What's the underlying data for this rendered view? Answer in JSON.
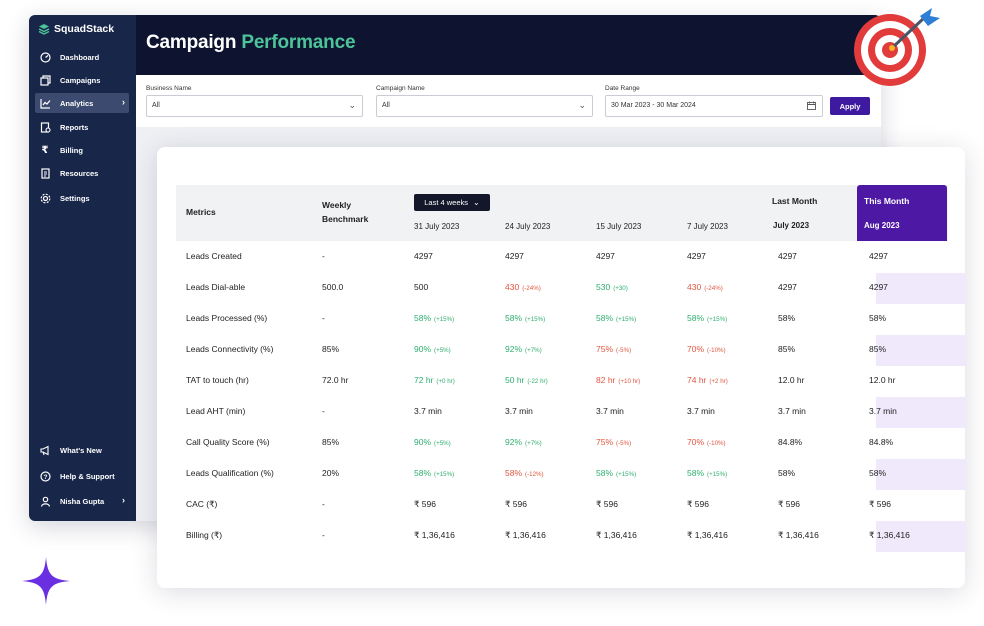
{
  "app": {
    "brand": "SquadStack",
    "title_prefix": "Campaign",
    "title_highlight": "Performance"
  },
  "sidebar": {
    "items": [
      {
        "label": "Dashboard",
        "icon": "dashboard-icon"
      },
      {
        "label": "Campaigns",
        "icon": "campaigns-icon"
      },
      {
        "label": "Analytics",
        "icon": "analytics-icon",
        "active": true
      },
      {
        "label": "Reports",
        "icon": "reports-icon"
      },
      {
        "label": "Billing",
        "icon": "rupee-icon"
      },
      {
        "label": "Resources",
        "icon": "resources-icon"
      },
      {
        "label": "Settings",
        "icon": "gear-icon"
      }
    ],
    "bottom_items": [
      {
        "label": "What's New",
        "icon": "megaphone-icon"
      },
      {
        "label": "Help & Support",
        "icon": "help-icon"
      },
      {
        "label": "Nisha Gupta",
        "icon": "user-icon"
      }
    ]
  },
  "filters": {
    "business_label": "Business Name",
    "business_value": "All",
    "campaign_label": "Campaign Name",
    "campaign_value": "All",
    "date_label": "Date Range",
    "date_value": "30 Mar 2023 - 30 Mar 2024",
    "apply_label": "Apply"
  },
  "table": {
    "headers": {
      "metrics": "Metrics",
      "weekly_benchmark_line1": "Weekly",
      "weekly_benchmark_line2": "Benchmark",
      "period_button": "Last 4 weeks",
      "weeks": [
        "31 July 2023",
        "24 July 2023",
        "15 July 2023",
        "7 July 2023"
      ],
      "last_month": "Last Month",
      "last_month_sub": "July 2023",
      "this_month": "This Month",
      "this_month_sub": "Aug 2023"
    },
    "rows": [
      {
        "metric": "Leads Created",
        "benchmark": "-",
        "weeks": [
          {
            "v": "4297",
            "d": ""
          },
          {
            "v": "4297",
            "d": ""
          },
          {
            "v": "4297",
            "d": ""
          },
          {
            "v": "4297",
            "d": ""
          }
        ],
        "last": "4297",
        "this": "4297",
        "hl": false
      },
      {
        "metric": "Leads Dial-able",
        "benchmark": "500.0",
        "weeks": [
          {
            "v": "500",
            "d": ""
          },
          {
            "v": "430",
            "d": "(-24%)",
            "s": "neg"
          },
          {
            "v": "530",
            "d": "(+30)",
            "s": "pos"
          },
          {
            "v": "430",
            "d": "(-24%)",
            "s": "neg"
          }
        ],
        "last": "4297",
        "this": "4297",
        "hl": true
      },
      {
        "metric": "Leads Processed (%)",
        "benchmark": "-",
        "weeks": [
          {
            "v": "58%",
            "d": "(+15%)",
            "s": "pos"
          },
          {
            "v": "58%",
            "d": "(+15%)",
            "s": "pos"
          },
          {
            "v": "58%",
            "d": "(+15%)",
            "s": "pos"
          },
          {
            "v": "58%",
            "d": "(+15%)",
            "s": "pos"
          }
        ],
        "last": "58%",
        "this": "58%",
        "hl": false
      },
      {
        "metric": "Leads  Connectivity (%)",
        "benchmark": "85%",
        "weeks": [
          {
            "v": "90%",
            "d": "(+5%)",
            "s": "pos"
          },
          {
            "v": "92%",
            "d": "(+7%)",
            "s": "pos"
          },
          {
            "v": "75%",
            "d": "(-5%)",
            "s": "neg"
          },
          {
            "v": "70%",
            "d": "(-10%)",
            "s": "neg"
          }
        ],
        "last": "85%",
        "this": "85%",
        "hl": true
      },
      {
        "metric": "TAT to touch (hr)",
        "benchmark": "72.0 hr",
        "weeks": [
          {
            "v": "72 hr",
            "d": "(+0 hr)",
            "s": "pos"
          },
          {
            "v": "50 hr",
            "d": "(-22 hr)",
            "s": "pos"
          },
          {
            "v": "82 hr",
            "d": "(+10 hr)",
            "s": "neg"
          },
          {
            "v": "74 hr",
            "d": "(+2 hr)",
            "s": "neg"
          }
        ],
        "last": "12.0 hr",
        "this": "12.0 hr",
        "hl": false
      },
      {
        "metric": "Lead AHT (min)",
        "benchmark": "-",
        "weeks": [
          {
            "v": "3.7 min",
            "d": ""
          },
          {
            "v": "3.7 min",
            "d": ""
          },
          {
            "v": "3.7 min",
            "d": ""
          },
          {
            "v": "3.7 min",
            "d": ""
          }
        ],
        "last": "3.7 min",
        "this": "3.7 min",
        "hl": true
      },
      {
        "metric": "Call Quality Score (%)",
        "benchmark": "85%",
        "weeks": [
          {
            "v": "90%",
            "d": "(+5%)",
            "s": "pos"
          },
          {
            "v": "92%",
            "d": "(+7%)",
            "s": "pos"
          },
          {
            "v": "75%",
            "d": "(-5%)",
            "s": "neg"
          },
          {
            "v": "70%",
            "d": "(-10%)",
            "s": "neg"
          }
        ],
        "last": "84.8%",
        "this": "84.8%",
        "hl": false
      },
      {
        "metric": "Leads Qualification (%)",
        "benchmark": "20%",
        "weeks": [
          {
            "v": "58%",
            "d": "(+15%)",
            "s": "pos"
          },
          {
            "v": "58%",
            "d": "(-12%)",
            "s": "neg"
          },
          {
            "v": "58%",
            "d": "(+15%)",
            "s": "pos"
          },
          {
            "v": "58%",
            "d": "(+15%)",
            "s": "pos"
          }
        ],
        "last": "58%",
        "this": "58%",
        "hl": true
      },
      {
        "metric": "CAC (₹)",
        "benchmark": "-",
        "weeks": [
          {
            "v": "₹ 596",
            "d": ""
          },
          {
            "v": "₹ 596",
            "d": ""
          },
          {
            "v": "₹ 596",
            "d": ""
          },
          {
            "v": "₹ 596",
            "d": ""
          }
        ],
        "last": "₹ 596",
        "this": "₹ 596",
        "hl": false
      },
      {
        "metric": "Billing (₹)",
        "benchmark": "-",
        "weeks": [
          {
            "v": "₹ 1,36,416",
            "d": ""
          },
          {
            "v": "₹ 1,36,416",
            "d": ""
          },
          {
            "v": "₹ 1,36,416",
            "d": ""
          },
          {
            "v": "₹ 1,36,416",
            "d": ""
          }
        ],
        "last": "₹ 1,36,416",
        "this": "₹ 1,36,416",
        "hl": true
      }
    ]
  },
  "colors": {
    "sidebar": "#18264a",
    "header": "#0e1430",
    "accent_green": "#4dc39a",
    "positive": "#2fae6e",
    "negative": "#e0563f",
    "this_month": "#4c18a4",
    "apply": "#3e1aa0"
  }
}
